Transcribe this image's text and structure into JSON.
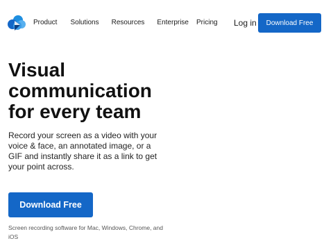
{
  "brand": {
    "logo_icon": "loom-style-cloud-play-icon",
    "colors": {
      "primary": "#1467c7",
      "logo_light": "#5fb3f0",
      "logo_dark": "#1467c7",
      "text": "#1a1a1a",
      "muted": "#555555"
    }
  },
  "nav": {
    "items": [
      {
        "label": "Product"
      },
      {
        "label": "Solutions"
      },
      {
        "label": "Resources"
      },
      {
        "label": "Enterprise"
      },
      {
        "label": "Pricing"
      }
    ],
    "login_label": "Log in",
    "cta_label": "Download Free"
  },
  "hero": {
    "title_lines": [
      "Visual",
      "communication",
      "for every team"
    ],
    "description_lines": [
      "Record your screen as a video with your",
      "voice & face, an annotated image, or a",
      "GIF and instantly share it as a link to get",
      "your point across."
    ],
    "cta_label": "Download Free",
    "note_lines": [
      "Screen recording software for Mac, Windows, Chrome, and",
      "iOS"
    ]
  }
}
